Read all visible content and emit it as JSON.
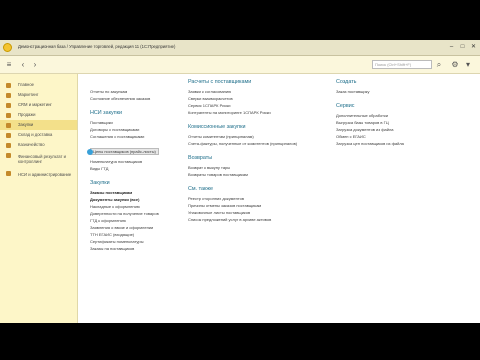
{
  "window": {
    "title": "Демонстрационная база / Управление торговлей, редакция 11 (1С:Предприятие)"
  },
  "toolbar": {
    "search_placeholder": "Поиск (Ctrl+Shift+F)"
  },
  "sidebar": {
    "items": [
      {
        "label": "Главное"
      },
      {
        "label": "Маркетинг"
      },
      {
        "label": "CRM и маркетинг"
      },
      {
        "label": "Продажи"
      },
      {
        "label": "Закупки"
      },
      {
        "label": "Склад и доставка"
      },
      {
        "label": "Казначейство"
      },
      {
        "label": "Финансовый результат и контроллинг"
      },
      {
        "label": "НСИ и администрирование"
      }
    ]
  },
  "columns": {
    "col1": {
      "top_links": [
        "Отчеты по закупкам",
        "Состояние обеспечения заказов"
      ],
      "nsi_title": "НСИ закупки",
      "nsi_links": [
        "Поставщики",
        "Договоры с поставщиками",
        "Соглашения с поставщиками",
        "Цены поставщиков (прайс-листы)",
        "Номенклатура поставщиков",
        "Виды ГТД"
      ],
      "zakupki_title": "Закупки",
      "zakupki_links": [
        "Заказы поставщикам",
        "Документы закупки (все)",
        "Накладные к оформлению",
        "Доверенности на получение товаров",
        "ГТД к оформлению",
        "Заявления о ввозе и оформлении",
        "ТТН ЕГАИС (входящие)",
        "Сертификаты номенклатуры",
        "Заказы на поставщиков"
      ]
    },
    "col2": {
      "rasch_title": "Расчеты с поставщиками",
      "rasch_links": [
        "Заявки к согласованию",
        "Сверки взаиморасчетов",
        "Сервис 1СПАРК Риски",
        "Контрагенты на мониторинге 1СПАРК Риски"
      ],
      "komis_title": "Комиссионные закупки",
      "komis_links": [
        "Отчеты комитентам (принципалам)",
        "Счета-фактуры, полученные от комитентов (принципалов)"
      ],
      "vozvr_title": "Возвраты",
      "vozvr_links": [
        "Возврат к выкупу тары",
        "Возвраты товаров поставщикам"
      ],
      "sm_title": "См. также",
      "sm_links": [
        "Реестр сторонних документов",
        "Причины отмены заказов поставщикам",
        "Упаковочные листы поставщиков",
        "Список предложений услуг в архиве активов"
      ]
    },
    "col3": {
      "create_title": "Создать",
      "create_links": [
        "Заказ поставщику"
      ],
      "service_title": "Сервис",
      "service_links": [
        "Дополнительные обработки",
        "Выгрузка базы товаров в ГЦ",
        "Загрузка документов из файла",
        "Обмен с ЕГАИС",
        "Загрузка цен поставщиков из файла"
      ]
    }
  }
}
